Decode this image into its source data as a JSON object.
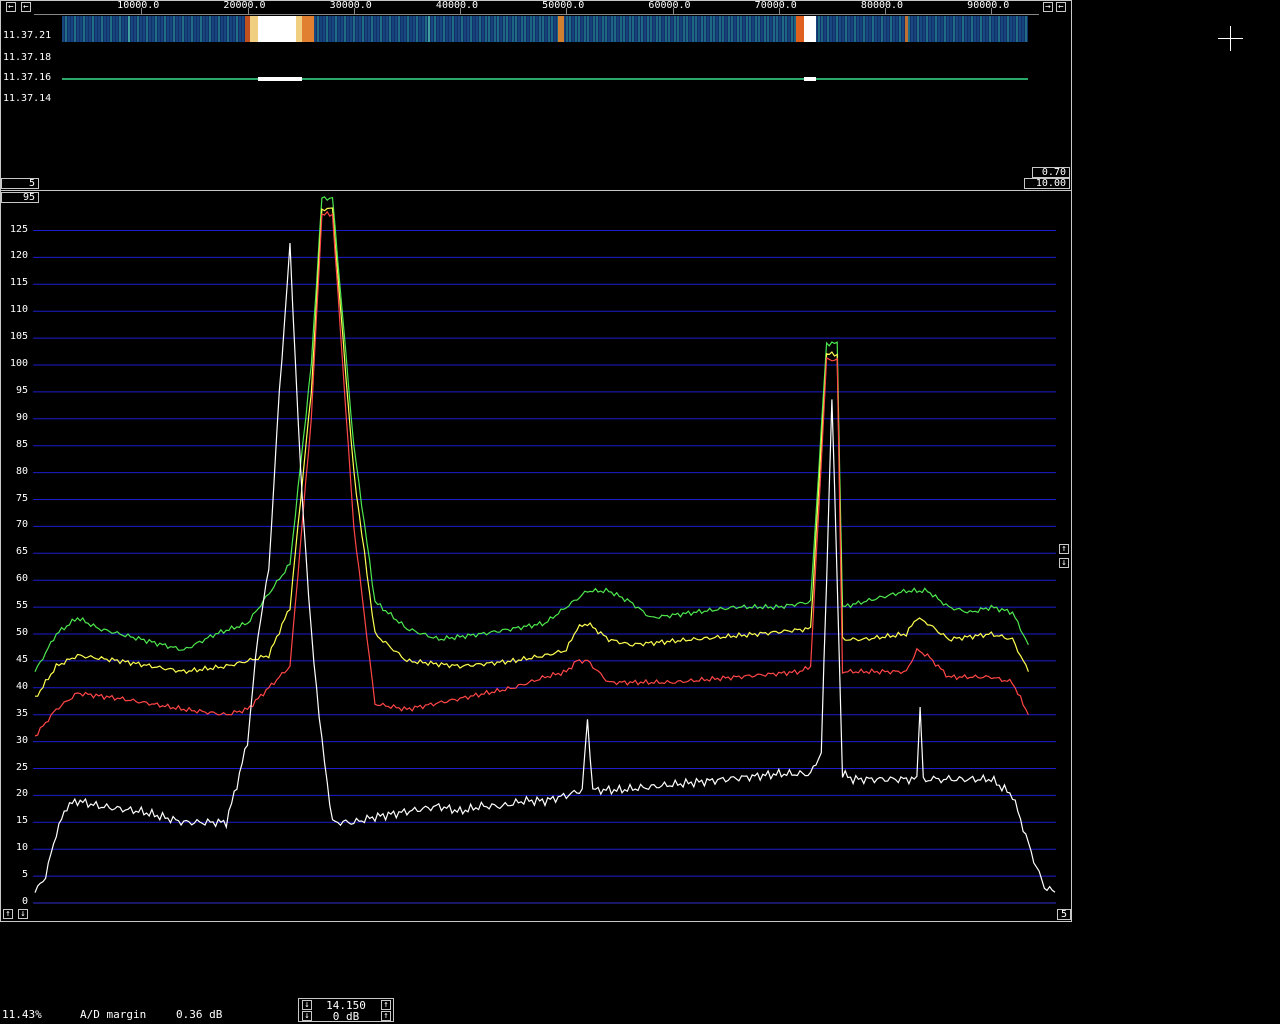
{
  "waterfall": {
    "freq_ticks": [
      "10000.0",
      "20000.0",
      "30000.0",
      "40000.0",
      "50000.0",
      "60000.0",
      "70000.0",
      "80000.0",
      "90000.0"
    ],
    "time_labels": [
      "11.37.21",
      "11.37.18",
      "11.37.16",
      "11.37.14"
    ],
    "left_box": "5",
    "right_box_top": "0.70",
    "right_box_bottom": "10.00"
  },
  "spectrum": {
    "top_box": "95",
    "bottom_right_box": "5",
    "colors": {
      "green": "#4ee84e",
      "yellow": "#ffff50",
      "red": "#ff4646",
      "white": "#ffffff",
      "grid": "#1c1ccc"
    }
  },
  "chart_data": {
    "type": "line",
    "xlabel": "",
    "ylabel": "",
    "xlim": [
      0,
      96000
    ],
    "ylim": [
      0,
      130
    ],
    "y_ticks": [
      0,
      5,
      10,
      15,
      20,
      25,
      30,
      35,
      40,
      45,
      50,
      55,
      60,
      65,
      70,
      75,
      80,
      85,
      90,
      95,
      100,
      105,
      110,
      115,
      120,
      125
    ],
    "grid": true,
    "series": [
      {
        "color": "#4ee84e",
        "x": [
          0,
          2000,
          4000,
          6000,
          10000,
          14000,
          17000,
          20000,
          24000,
          26000,
          27000,
          28000,
          30000,
          32000,
          35000,
          38000,
          42000,
          45000,
          48000,
          50000,
          52000,
          54000,
          56000,
          58000,
          62000,
          66000,
          70000,
          73000,
          74500,
          75500,
          76000,
          78000,
          80000,
          82000,
          84000,
          86000,
          88000,
          90000,
          92000,
          93500
        ],
        "y": [
          43,
          50,
          53,
          51,
          49,
          47,
          50,
          52,
          63,
          100,
          131,
          131,
          85,
          56,
          51,
          49,
          50,
          51,
          52,
          55,
          58,
          58,
          56,
          53,
          54,
          55,
          55,
          56,
          104,
          104,
          55,
          56,
          57,
          58,
          58,
          55,
          54,
          55,
          54,
          48
        ]
      },
      {
        "color": "#ffff50",
        "x": [
          0,
          2000,
          4000,
          8000,
          14000,
          18000,
          22000,
          24000,
          26000,
          27000,
          28000,
          30000,
          32000,
          35000,
          40000,
          45000,
          48000,
          50000,
          51000,
          52000,
          54000,
          56000,
          62000,
          68000,
          73000,
          74500,
          75500,
          76000,
          78000,
          82000,
          83000,
          84000,
          86000,
          90000,
          92000,
          93500
        ],
        "y": [
          38,
          44,
          46,
          45,
          43,
          44,
          46,
          55,
          95,
          129,
          129,
          80,
          50,
          45,
          44,
          45,
          46,
          47,
          51,
          52,
          49,
          48,
          49,
          50,
          51,
          102,
          102,
          49,
          49,
          50,
          53,
          52,
          49,
          50,
          49,
          43
        ]
      },
      {
        "color": "#ff4646",
        "x": [
          0,
          2000,
          4000,
          8000,
          14000,
          18000,
          20000,
          24000,
          26000,
          27000,
          28000,
          30000,
          32000,
          35000,
          40000,
          45000,
          48000,
          50000,
          51000,
          52000,
          54000,
          60000,
          66000,
          72000,
          73000,
          74500,
          75500,
          76000,
          78000,
          82000,
          83000,
          84000,
          86000,
          90000,
          92000,
          93500
        ],
        "y": [
          31,
          36,
          39,
          38,
          36,
          35,
          36,
          44,
          90,
          128,
          128,
          70,
          37,
          36,
          38,
          40,
          42,
          43,
          45,
          45,
          41,
          41,
          42,
          43,
          44,
          101,
          101,
          43,
          43,
          43,
          47,
          46,
          42,
          42,
          41,
          35
        ]
      },
      {
        "color": "#ffffff",
        "x": [
          0,
          1000,
          2000,
          3000,
          4000,
          6000,
          10000,
          12000,
          14000,
          18000,
          19000,
          20000,
          21000,
          22000,
          23000,
          24000,
          25000,
          26000,
          27000,
          28000,
          30000,
          32000,
          35000,
          38000,
          40000,
          42000,
          44000,
          46000,
          48000,
          50000,
          51500,
          52000,
          52500,
          55000,
          60000,
          65000,
          70000,
          73000,
          74000,
          74500,
          75000,
          75500,
          76000,
          77000,
          80000,
          83000,
          83300,
          83600,
          86000,
          90000,
          92000,
          93000,
          94000,
          95000,
          96000
        ],
        "y": [
          2,
          5,
          13,
          18,
          19,
          18,
          17,
          16,
          15,
          15,
          22,
          30,
          50,
          62,
          95,
          122,
          80,
          50,
          30,
          15,
          15,
          16,
          17,
          18,
          17,
          18,
          18,
          19,
          19,
          20,
          21,
          34,
          21,
          21,
          22,
          23,
          24,
          24,
          28,
          60,
          94,
          60,
          24,
          23,
          23,
          23,
          37,
          23,
          23,
          23,
          20,
          14,
          8,
          3,
          2
        ]
      }
    ]
  },
  "status_bar": {
    "percent": "11.43%",
    "ad_margin_label": "A/D margin",
    "ad_margin_value": "0.36 dB",
    "box_top": "14.150",
    "box_bottom": "0 dB"
  }
}
